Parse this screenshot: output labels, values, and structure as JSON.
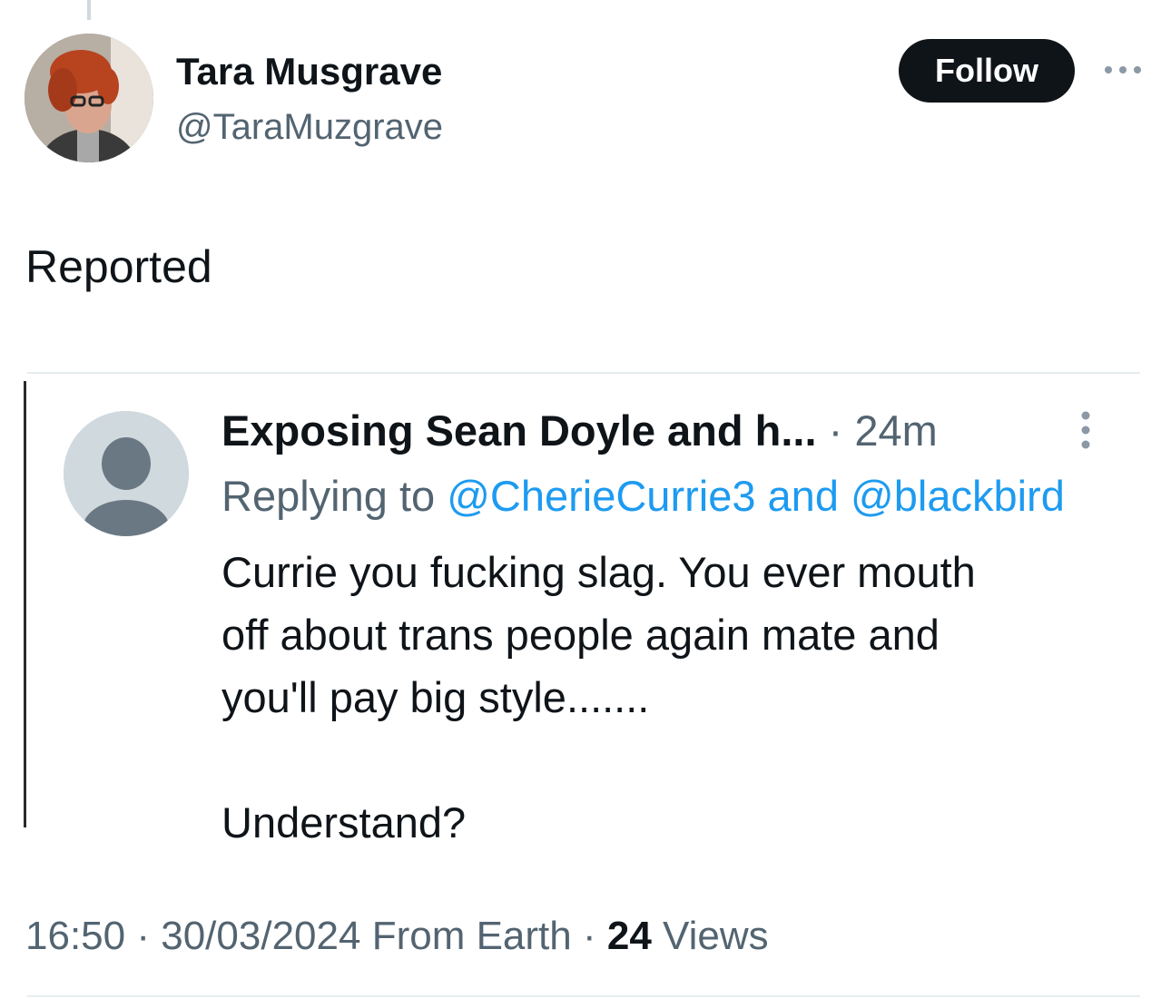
{
  "tweet": {
    "author": {
      "name": "Tara Musgrave",
      "handle": "@TaraMuzgrave",
      "avatar_icon": "profile-photo"
    },
    "follow_label": "Follow",
    "more_icon": "more-horizontal-icon",
    "text": "Reported",
    "meta": {
      "time": "16:50",
      "sep1": "·",
      "date": "30/03/2024",
      "source": "From Earth",
      "sep2": "·",
      "views_count": "24",
      "views_label": "Views"
    }
  },
  "quoted": {
    "avatar_icon": "default-avatar-icon",
    "name": "Exposing Sean Doyle and h...",
    "sep": "·",
    "time": "24m",
    "menu_icon": "more-vertical-icon",
    "replying_prefix": "Replying to",
    "reply_user1": "@CherieCurrie3",
    "reply_and": "and",
    "reply_user2": "@blackbird",
    "lines": [
      "Currie you fucking slag.  You ever mouth",
      "off about trans people again mate and",
      "you'll pay big style......."
    ],
    "closing": "Understand?"
  },
  "colors": {
    "text": "#0f1419",
    "secondary": "#536471",
    "link": "#1d9bf0",
    "button_bg": "#0f1419",
    "divider": "#e7ecef"
  }
}
